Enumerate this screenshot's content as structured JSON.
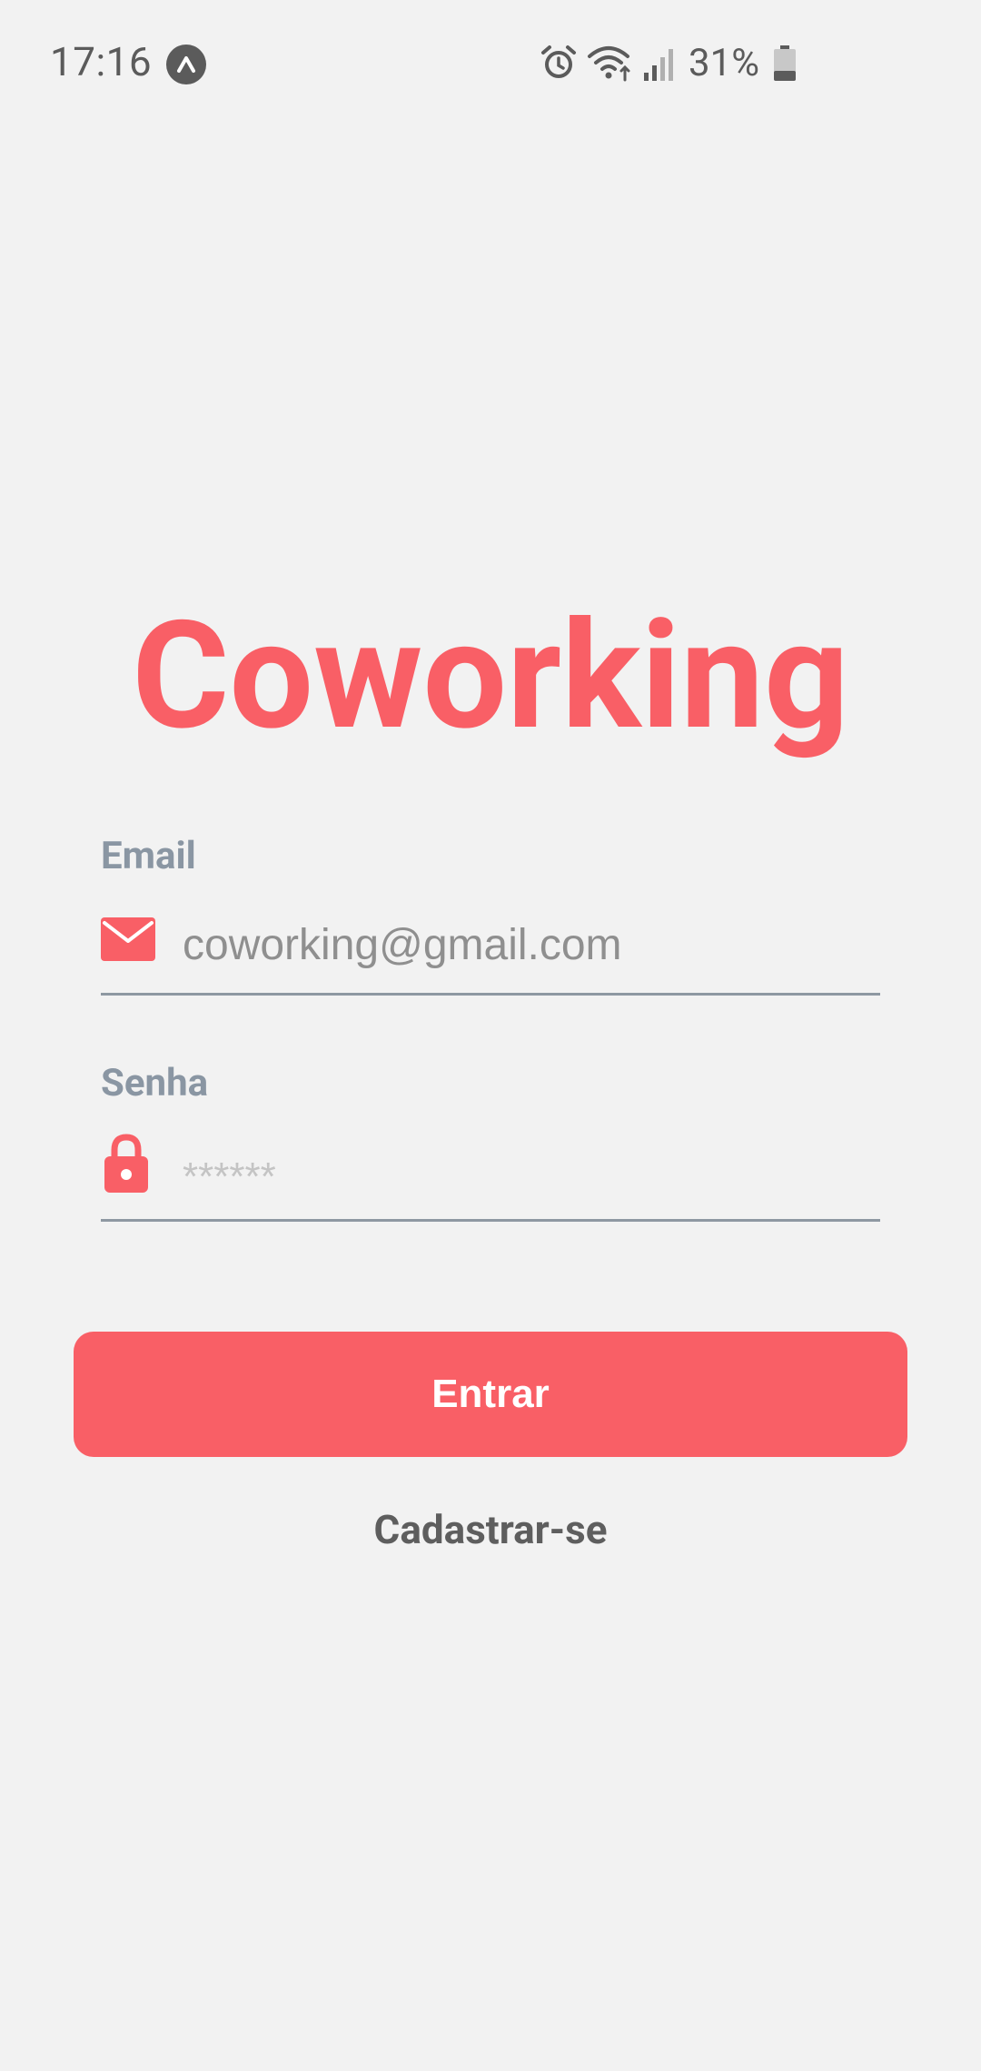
{
  "status_bar": {
    "time": "17:16",
    "battery_percent": "31%",
    "battery_level": 0.31,
    "icons": [
      "app-notification-icon",
      "alarm-icon",
      "wifi-icon",
      "signal-icon",
      "battery-icon"
    ]
  },
  "app": {
    "title": "Coworking",
    "accent_color": "#f95f66"
  },
  "form": {
    "email_label": "Email",
    "email_value": "coworking@gmail.com",
    "password_label": "Senha",
    "password_placeholder": "******",
    "submit_label": "Entrar",
    "register_label": "Cadastrar-se"
  }
}
